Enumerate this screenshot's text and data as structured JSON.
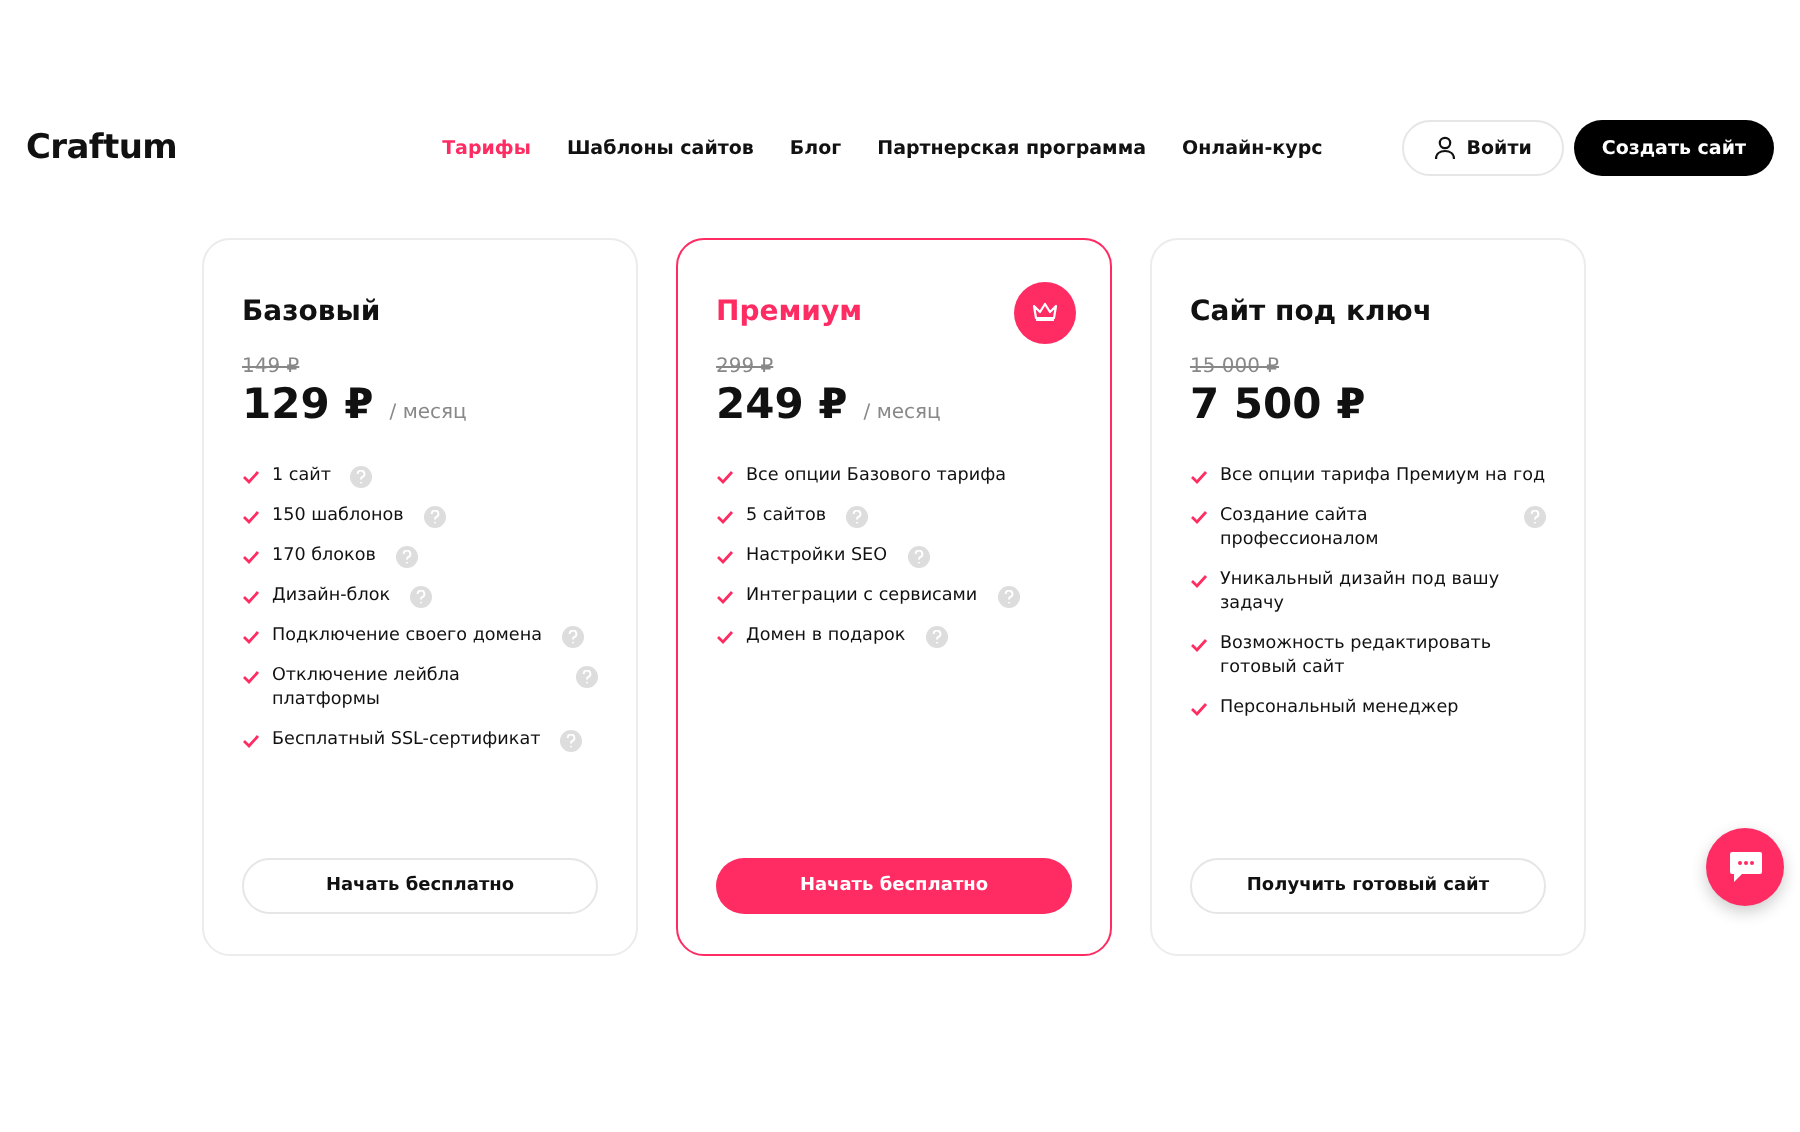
{
  "header": {
    "logo": "Craftum",
    "nav": [
      {
        "label": "Тарифы",
        "selected": true
      },
      {
        "label": "Шаблоны сайтов",
        "selected": false
      },
      {
        "label": "Блог",
        "selected": false
      },
      {
        "label": "Партнерская программа",
        "selected": false
      },
      {
        "label": "Онлайн-курс",
        "selected": false
      }
    ],
    "login": "Войти",
    "create": "Создать сайт"
  },
  "plans": [
    {
      "title": "Базовый",
      "featured": false,
      "old_price": "149 ₽",
      "price": "129 ₽",
      "period": "/ месяц",
      "features": [
        {
          "text": "1 сайт",
          "hint": true
        },
        {
          "text": "150 шаблонов",
          "hint": true
        },
        {
          "text": "170 блоков",
          "hint": true
        },
        {
          "text": "Дизайн-блок",
          "hint": true
        },
        {
          "text": "Подключение своего домена",
          "hint": true
        },
        {
          "text": "Отключение лейбла платформы",
          "hint": true
        },
        {
          "text": "Бесплатный SSL-сертификат",
          "hint": true
        }
      ],
      "button": "Начать бесплатно"
    },
    {
      "title": "Премиум",
      "featured": true,
      "old_price": "299 ₽",
      "price": "249 ₽",
      "period": "/ месяц",
      "features": [
        {
          "text": "Все опции Базового тарифа",
          "hint": false
        },
        {
          "text": "5 сайтов",
          "hint": true
        },
        {
          "text": "Настройки SEO",
          "hint": true
        },
        {
          "text": "Интеграции с сервисами",
          "hint": true
        },
        {
          "text": "Домен в подарок",
          "hint": true
        }
      ],
      "button": "Начать бесплатно"
    },
    {
      "title": "Сайт под ключ",
      "featured": false,
      "old_price": "15 000 ₽",
      "price": "7 500 ₽",
      "features": [
        {
          "text": "Все опции тарифа Премиум на год",
          "hint": false
        },
        {
          "text": "Создание сайта профессионалом",
          "hint": true
        },
        {
          "text": "Уникальный дизайн под вашу задачу",
          "hint": false
        },
        {
          "text": "Возможность редактировать готовый сайт",
          "hint": false
        },
        {
          "text": "Персональный менеджер",
          "hint": false
        }
      ],
      "button": "Получить готовый сайт"
    }
  ]
}
